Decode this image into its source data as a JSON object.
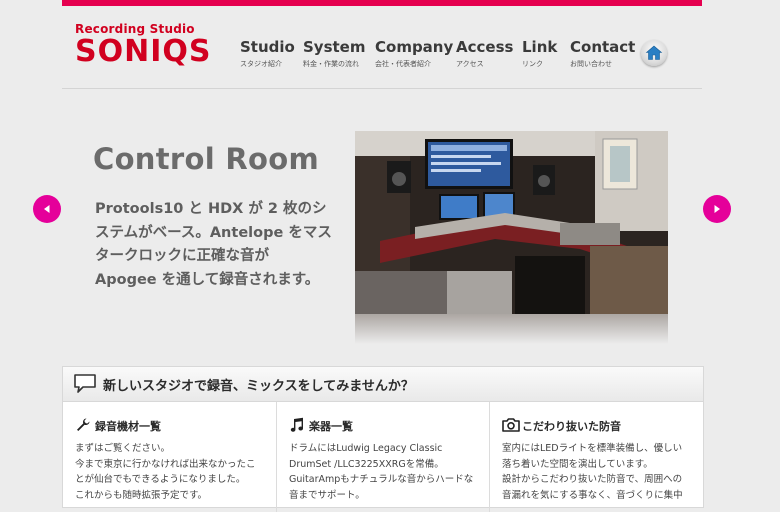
{
  "header": {
    "logo_sub": "Recording Studio",
    "logo_main": "SONIQS",
    "nav": [
      {
        "label": "Studio",
        "sub": "スタジオ紹介"
      },
      {
        "label": "System",
        "sub": "料金・作業の流れ"
      },
      {
        "label": "Company",
        "sub": "会社・代表者紹介"
      },
      {
        "label": "Access",
        "sub": "アクセス"
      },
      {
        "label": "Link",
        "sub": "リンク"
      },
      {
        "label": "Contact",
        "sub": "お問い合わせ"
      }
    ],
    "home_icon": "home-icon"
  },
  "slider": {
    "title": "Control Room",
    "text": "Protools10 と HDX が 2 枚のシステムがベース。Antelope をマスタークロックに正確な音が Apogee を通して録音されます。",
    "prev_icon": "arrow-left-icon",
    "next_icon": "arrow-right-icon"
  },
  "info": {
    "heading": "新しいスタジオで録音、ミックスをしてみませんか？",
    "columns": [
      {
        "icon": "wrench-icon",
        "title": "録音機材一覧",
        "body": "まずはご覧ください。\n今まで東京に行かなければ出来なかったこ\nとが仙台でもできるようになりました。\nこれからも随時拡張予定です。"
      },
      {
        "icon": "music-note-icon",
        "title": "楽器一覧",
        "body": "ドラムにはLudwig Legacy Classic\nDrumSet /LLC3225XXRGを常備。\nGuitarAmpもナチュラルな音からハードな\n音までサポート。"
      },
      {
        "icon": "camera-icon",
        "title": "こだわり抜いた防音",
        "body": "室内にはLEDライトを標準装備し、優しい\n落ち着いた空間を演出しています。\n設計からこだわり抜いた防音で、周囲への\n音漏れを気にする事なく、音づくりに集中"
      }
    ]
  },
  "colors": {
    "brand_red": "#d1001f",
    "accent_pink": "#e5004f",
    "arrow_magenta": "#e5009a"
  }
}
